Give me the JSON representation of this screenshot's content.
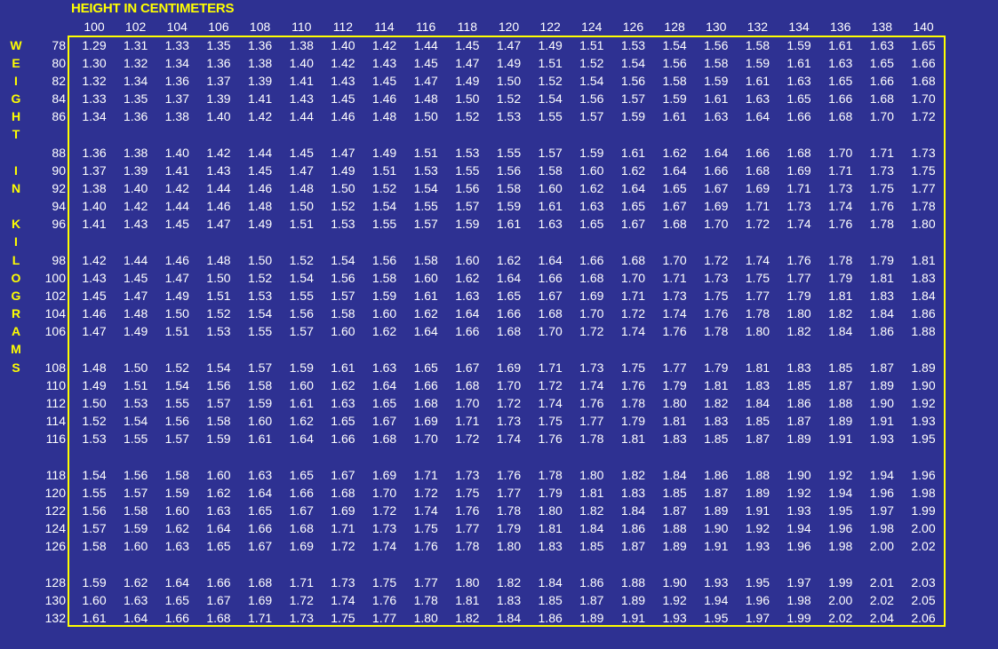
{
  "chart_data": {
    "type": "table",
    "title": "HEIGHT IN CENTIMETERS",
    "ylabel_letters": [
      "W",
      "E",
      "I",
      "G",
      "H",
      "T",
      "I",
      "N",
      "K",
      "I",
      "L",
      "O",
      "G",
      "R",
      "A",
      "M",
      "S"
    ],
    "heights": [
      "100",
      "102",
      "104",
      "106",
      "108",
      "110",
      "112",
      "114",
      "116",
      "118",
      "120",
      "122",
      "124",
      "126",
      "128",
      "130",
      "132",
      "134",
      "136",
      "138",
      "140"
    ],
    "weights": [
      "78",
      "80",
      "82",
      "84",
      "86",
      "88",
      "90",
      "92",
      "94",
      "96",
      "98",
      "100",
      "102",
      "104",
      "106",
      "108",
      "110",
      "112",
      "114",
      "116",
      "118",
      "120",
      "122",
      "124",
      "126",
      "128",
      "130",
      "132"
    ],
    "values": [
      [
        "1.29",
        "1.31",
        "1.33",
        "1.35",
        "1.36",
        "1.38",
        "1.40",
        "1.42",
        "1.44",
        "1.45",
        "1.47",
        "1.49",
        "1.51",
        "1.53",
        "1.54",
        "1.56",
        "1.58",
        "1.59",
        "1.61",
        "1.63",
        "1.65"
      ],
      [
        "1.30",
        "1.32",
        "1.34",
        "1.36",
        "1.38",
        "1.40",
        "1.42",
        "1.43",
        "1.45",
        "1.47",
        "1.49",
        "1.51",
        "1.52",
        "1.54",
        "1.56",
        "1.58",
        "1.59",
        "1.61",
        "1.63",
        "1.65",
        "1.66"
      ],
      [
        "1.32",
        "1.34",
        "1.36",
        "1.37",
        "1.39",
        "1.41",
        "1.43",
        "1.45",
        "1.47",
        "1.49",
        "1.50",
        "1.52",
        "1.54",
        "1.56",
        "1.58",
        "1.59",
        "1.61",
        "1.63",
        "1.65",
        "1.66",
        "1.68"
      ],
      [
        "1.33",
        "1.35",
        "1.37",
        "1.39",
        "1.41",
        "1.43",
        "1.45",
        "1.46",
        "1.48",
        "1.50",
        "1.52",
        "1.54",
        "1.56",
        "1.57",
        "1.59",
        "1.61",
        "1.63",
        "1.65",
        "1.66",
        "1.68",
        "1.70"
      ],
      [
        "1.34",
        "1.36",
        "1.38",
        "1.40",
        "1.42",
        "1.44",
        "1.46",
        "1.48",
        "1.50",
        "1.52",
        "1.53",
        "1.55",
        "1.57",
        "1.59",
        "1.61",
        "1.63",
        "1.64",
        "1.66",
        "1.68",
        "1.70",
        "1.72"
      ],
      [
        "1.36",
        "1.38",
        "1.40",
        "1.42",
        "1.44",
        "1.45",
        "1.47",
        "1.49",
        "1.51",
        "1.53",
        "1.55",
        "1.57",
        "1.59",
        "1.61",
        "1.62",
        "1.64",
        "1.66",
        "1.68",
        "1.70",
        "1.71",
        "1.73"
      ],
      [
        "1.37",
        "1.39",
        "1.41",
        "1.43",
        "1.45",
        "1.47",
        "1.49",
        "1.51",
        "1.53",
        "1.55",
        "1.56",
        "1.58",
        "1.60",
        "1.62",
        "1.64",
        "1.66",
        "1.68",
        "1.69",
        "1.71",
        "1.73",
        "1.75"
      ],
      [
        "1.38",
        "1.40",
        "1.42",
        "1.44",
        "1.46",
        "1.48",
        "1.50",
        "1.52",
        "1.54",
        "1.56",
        "1.58",
        "1.60",
        "1.62",
        "1.64",
        "1.65",
        "1.67",
        "1.69",
        "1.71",
        "1.73",
        "1.75",
        "1.77"
      ],
      [
        "1.40",
        "1.42",
        "1.44",
        "1.46",
        "1.48",
        "1.50",
        "1.52",
        "1.54",
        "1.55",
        "1.57",
        "1.59",
        "1.61",
        "1.63",
        "1.65",
        "1.67",
        "1.69",
        "1.71",
        "1.73",
        "1.74",
        "1.76",
        "1.78"
      ],
      [
        "1.41",
        "1.43",
        "1.45",
        "1.47",
        "1.49",
        "1.51",
        "1.53",
        "1.55",
        "1.57",
        "1.59",
        "1.61",
        "1.63",
        "1.65",
        "1.67",
        "1.68",
        "1.70",
        "1.72",
        "1.74",
        "1.76",
        "1.78",
        "1.80"
      ],
      [
        "1.42",
        "1.44",
        "1.46",
        "1.48",
        "1.50",
        "1.52",
        "1.54",
        "1.56",
        "1.58",
        "1.60",
        "1.62",
        "1.64",
        "1.66",
        "1.68",
        "1.70",
        "1.72",
        "1.74",
        "1.76",
        "1.78",
        "1.79",
        "1.81"
      ],
      [
        "1.43",
        "1.45",
        "1.47",
        "1.50",
        "1.52",
        "1.54",
        "1.56",
        "1.58",
        "1.60",
        "1.62",
        "1.64",
        "1.66",
        "1.68",
        "1.70",
        "1.71",
        "1.73",
        "1.75",
        "1.77",
        "1.79",
        "1.81",
        "1.83"
      ],
      [
        "1.45",
        "1.47",
        "1.49",
        "1.51",
        "1.53",
        "1.55",
        "1.57",
        "1.59",
        "1.61",
        "1.63",
        "1.65",
        "1.67",
        "1.69",
        "1.71",
        "1.73",
        "1.75",
        "1.77",
        "1.79",
        "1.81",
        "1.83",
        "1.84"
      ],
      [
        "1.46",
        "1.48",
        "1.50",
        "1.52",
        "1.54",
        "1.56",
        "1.58",
        "1.60",
        "1.62",
        "1.64",
        "1.66",
        "1.68",
        "1.70",
        "1.72",
        "1.74",
        "1.76",
        "1.78",
        "1.80",
        "1.82",
        "1.84",
        "1.86"
      ],
      [
        "1.47",
        "1.49",
        "1.51",
        "1.53",
        "1.55",
        "1.57",
        "1.60",
        "1.62",
        "1.64",
        "1.66",
        "1.68",
        "1.70",
        "1.72",
        "1.74",
        "1.76",
        "1.78",
        "1.80",
        "1.82",
        "1.84",
        "1.86",
        "1.88"
      ],
      [
        "1.48",
        "1.50",
        "1.52",
        "1.54",
        "1.57",
        "1.59",
        "1.61",
        "1.63",
        "1.65",
        "1.67",
        "1.69",
        "1.71",
        "1.73",
        "1.75",
        "1.77",
        "1.79",
        "1.81",
        "1.83",
        "1.85",
        "1.87",
        "1.89"
      ],
      [
        "1.49",
        "1.51",
        "1.54",
        "1.56",
        "1.58",
        "1.60",
        "1.62",
        "1.64",
        "1.66",
        "1.68",
        "1.70",
        "1.72",
        "1.74",
        "1.76",
        "1.79",
        "1.81",
        "1.83",
        "1.85",
        "1.87",
        "1.89",
        "1.90"
      ],
      [
        "1.50",
        "1.53",
        "1.55",
        "1.57",
        "1.59",
        "1.61",
        "1.63",
        "1.65",
        "1.68",
        "1.70",
        "1.72",
        "1.74",
        "1.76",
        "1.78",
        "1.80",
        "1.82",
        "1.84",
        "1.86",
        "1.88",
        "1.90",
        "1.92"
      ],
      [
        "1.52",
        "1.54",
        "1.56",
        "1.58",
        "1.60",
        "1.62",
        "1.65",
        "1.67",
        "1.69",
        "1.71",
        "1.73",
        "1.75",
        "1.77",
        "1.79",
        "1.81",
        "1.83",
        "1.85",
        "1.87",
        "1.89",
        "1.91",
        "1.93"
      ],
      [
        "1.53",
        "1.55",
        "1.57",
        "1.59",
        "1.61",
        "1.64",
        "1.66",
        "1.68",
        "1.70",
        "1.72",
        "1.74",
        "1.76",
        "1.78",
        "1.81",
        "1.83",
        "1.85",
        "1.87",
        "1.89",
        "1.91",
        "1.93",
        "1.95"
      ],
      [
        "1.54",
        "1.56",
        "1.58",
        "1.60",
        "1.63",
        "1.65",
        "1.67",
        "1.69",
        "1.71",
        "1.73",
        "1.76",
        "1.78",
        "1.80",
        "1.82",
        "1.84",
        "1.86",
        "1.88",
        "1.90",
        "1.92",
        "1.94",
        "1.96"
      ],
      [
        "1.55",
        "1.57",
        "1.59",
        "1.62",
        "1.64",
        "1.66",
        "1.68",
        "1.70",
        "1.72",
        "1.75",
        "1.77",
        "1.79",
        "1.81",
        "1.83",
        "1.85",
        "1.87",
        "1.89",
        "1.92",
        "1.94",
        "1.96",
        "1.98"
      ],
      [
        "1.56",
        "1.58",
        "1.60",
        "1.63",
        "1.65",
        "1.67",
        "1.69",
        "1.72",
        "1.74",
        "1.76",
        "1.78",
        "1.80",
        "1.82",
        "1.84",
        "1.87",
        "1.89",
        "1.91",
        "1.93",
        "1.95",
        "1.97",
        "1.99"
      ],
      [
        "1.57",
        "1.59",
        "1.62",
        "1.64",
        "1.66",
        "1.68",
        "1.71",
        "1.73",
        "1.75",
        "1.77",
        "1.79",
        "1.81",
        "1.84",
        "1.86",
        "1.88",
        "1.90",
        "1.92",
        "1.94",
        "1.96",
        "1.98",
        "2.00"
      ],
      [
        "1.58",
        "1.60",
        "1.63",
        "1.65",
        "1.67",
        "1.69",
        "1.72",
        "1.74",
        "1.76",
        "1.78",
        "1.80",
        "1.83",
        "1.85",
        "1.87",
        "1.89",
        "1.91",
        "1.93",
        "1.96",
        "1.98",
        "2.00",
        "2.02"
      ],
      [
        "1.59",
        "1.62",
        "1.64",
        "1.66",
        "1.68",
        "1.71",
        "1.73",
        "1.75",
        "1.77",
        "1.80",
        "1.82",
        "1.84",
        "1.86",
        "1.88",
        "1.90",
        "1.93",
        "1.95",
        "1.97",
        "1.99",
        "2.01",
        "2.03"
      ],
      [
        "1.60",
        "1.63",
        "1.65",
        "1.67",
        "1.69",
        "1.72",
        "1.74",
        "1.76",
        "1.78",
        "1.81",
        "1.83",
        "1.85",
        "1.87",
        "1.89",
        "1.92",
        "1.94",
        "1.96",
        "1.98",
        "2.00",
        "2.02",
        "2.05"
      ],
      [
        "1.61",
        "1.64",
        "1.66",
        "1.68",
        "1.71",
        "1.73",
        "1.75",
        "1.77",
        "1.80",
        "1.82",
        "1.84",
        "1.86",
        "1.89",
        "1.91",
        "1.93",
        "1.95",
        "1.97",
        "1.99",
        "2.02",
        "2.04",
        "2.06"
      ]
    ],
    "colors": {
      "background": "#2E3192",
      "accent": "#FFFF00",
      "text": "#FFFFFF"
    }
  }
}
